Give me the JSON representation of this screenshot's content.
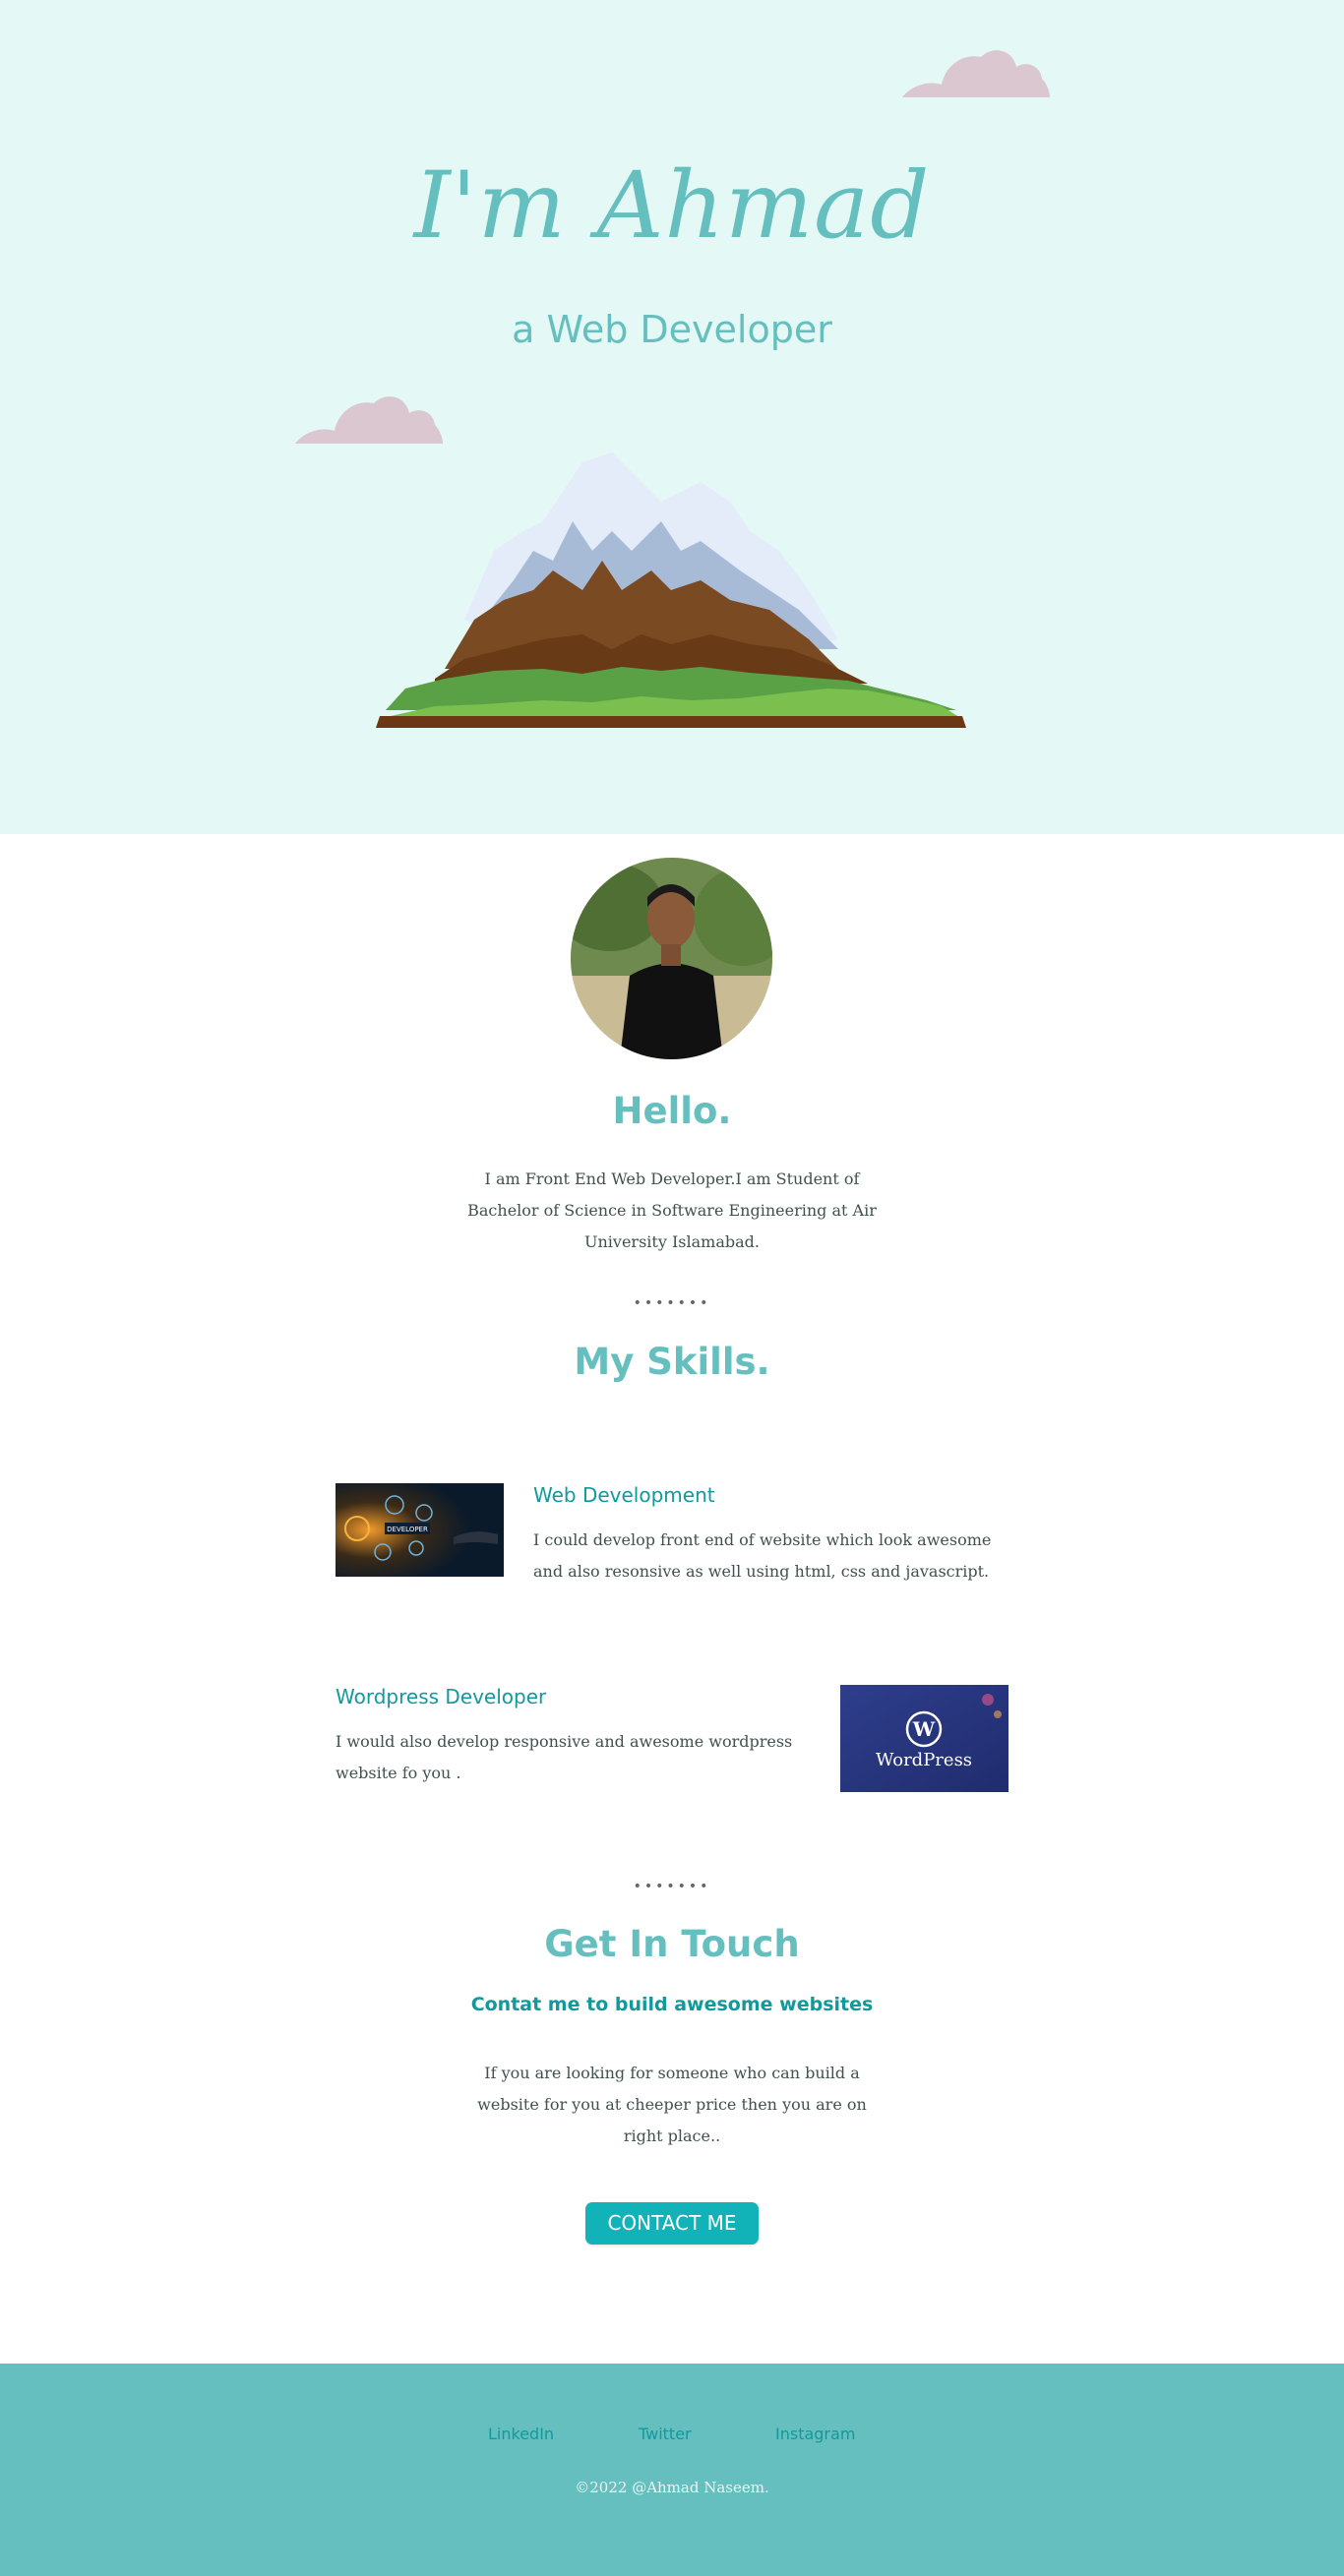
{
  "hero": {
    "title": "I'm Ahmad",
    "subtitle": "a Web Developer",
    "background_color": "#e4f8f5",
    "accent_color": "#66bfbf",
    "cloud_color": "#dac7cf"
  },
  "about": {
    "heading": "Hello.",
    "text": "I am Front End Web Developer.I am Student of Bachelor of Science in Software Engineering at Air University Islamabad."
  },
  "divider": "•••••••",
  "skills": {
    "heading": "My Skills.",
    "items": [
      {
        "title": "Web Development",
        "description": "I could develop front end of website which look awesome and also resonsive as well using html, css and javascript.",
        "image_caption": "DEVELOPER"
      },
      {
        "title": "Wordpress Developer",
        "description": "I would also develop responsive and awesome wordpress website fo you .",
        "image_caption": "WordPress"
      }
    ]
  },
  "contact": {
    "heading": "Get In Touch",
    "subheading": "Contat me to build awesome websites",
    "text": "If you are looking for someone who can build a website for you at cheeper price then you are on right place..",
    "button_label": "CONTACT ME",
    "button_color": "#11b2b8"
  },
  "footer": {
    "links": [
      "LinkedIn",
      "Twitter",
      "Instagram"
    ],
    "copyright": "©2022 @Ahmad Naseem.",
    "background_color": "#66bfbf"
  }
}
